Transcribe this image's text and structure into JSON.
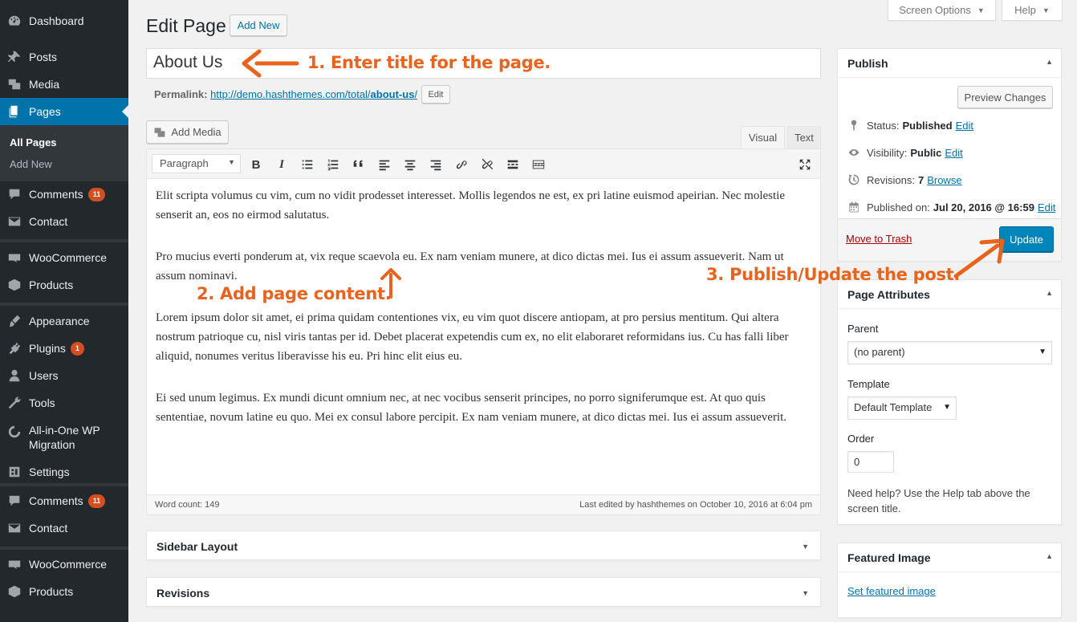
{
  "sidebar": {
    "items": [
      {
        "label": "Dashboard",
        "icon": "dashboard-icon"
      },
      {
        "label": "Posts",
        "icon": "pin-icon"
      },
      {
        "label": "Media",
        "icon": "media-icon"
      },
      {
        "label": "Pages",
        "icon": "pages-icon",
        "active": true
      },
      {
        "label": "Comments",
        "icon": "comments-icon",
        "badge": "11"
      },
      {
        "label": "Contact",
        "icon": "mail-icon"
      },
      {
        "label": "WooCommerce",
        "icon": "woo-icon"
      },
      {
        "label": "Products",
        "icon": "products-icon"
      },
      {
        "label": "Appearance",
        "icon": "brush-icon"
      },
      {
        "label": "Plugins",
        "icon": "plugin-icon",
        "badge": "1"
      },
      {
        "label": "Users",
        "icon": "users-icon"
      },
      {
        "label": "Tools",
        "icon": "wrench-icon"
      },
      {
        "label": "All-in-One WP Migration",
        "icon": "migration-icon"
      },
      {
        "label": "Settings",
        "icon": "settings-icon"
      },
      {
        "label": "Comments",
        "icon": "comments-icon",
        "badge": "11"
      },
      {
        "label": "Contact",
        "icon": "mail-icon"
      },
      {
        "label": "WooCommerce",
        "icon": "woo-icon"
      },
      {
        "label": "Products",
        "icon": "products-icon"
      }
    ],
    "submenu": [
      "All Pages",
      "Add New"
    ]
  },
  "header": {
    "title": "Edit Page",
    "add_new": "Add New",
    "screen_options": "Screen Options",
    "help": "Help"
  },
  "post": {
    "title": "About Us",
    "permalink_label": "Permalink:",
    "permalink_base": "http://demo.hashthemes.com/total/",
    "permalink_slug": "about-us",
    "permalink_trail": "/",
    "permalink_edit": "Edit"
  },
  "editor": {
    "add_media": "Add Media",
    "tab_visual": "Visual",
    "tab_text": "Text",
    "format": "Paragraph",
    "paragraphs": [
      "Elit scripta volumus cu vim, cum no vidit prodesset interesset. Mollis legendos ne est, ex pri latine euismod apeirian. Nec molestie senserit an, eos no eirmod salutatus.",
      "Pro mucius everti ponderum at, vix reque scaevola eu. Ex nam veniam munere, at dico dictas mei. Ius ei assum assueverit. Nam ut assum nominavi.",
      "Lorem ipsum dolor sit amet, ei prima quidam contentiones vix, eu vim quot discere antiopam, at pro persius mentitum. Qui altera nostrum patrioque cu, nisl viris tantas per id. Debet placerat expetendis cum ex, no elit elaboraret reformidans ius. Cu has falli liber aliquid, nonumes veritus liberavisse his eu. Pri hinc elit eius eu.",
      "Ei sed unum legimus. Ex mundi dicunt omnium nec, at nec vocibus senserit principes, no porro signiferumque est. At quo quis sententiae, novum latine eu quo. Mei ex consul labore percipit. Ex nam veniam munere, at dico dictas mei. Ius ei assum assueverit."
    ],
    "word_count": "Word count: 149",
    "last_edited": "Last edited by hashthemes on October 10, 2016 at 6:04 pm"
  },
  "boxes": {
    "sidebar_layout": "Sidebar Layout",
    "revisions": "Revisions"
  },
  "publish": {
    "title": "Publish",
    "preview": "Preview Changes",
    "status_label": "Status:",
    "status_value": "Published",
    "visibility_label": "Visibility:",
    "visibility_value": "Public",
    "revisions_label": "Revisions:",
    "revisions_value": "7",
    "browse": "Browse",
    "published_label": "Published on:",
    "published_value": "Jul 20, 2016 @ 16:59",
    "edit": "Edit",
    "trash": "Move to Trash",
    "update": "Update"
  },
  "page_attributes": {
    "title": "Page Attributes",
    "parent_label": "Parent",
    "parent_value": "(no parent)",
    "template_label": "Template",
    "template_value": "Default Template",
    "order_label": "Order",
    "order_value": "0",
    "help": "Need help? Use the Help tab above the screen title."
  },
  "featured_image": {
    "title": "Featured Image",
    "set_link": "Set featured image"
  },
  "annotations": {
    "step1": "1. Enter title for the page.",
    "step2": "2. Add page content.",
    "step3": "3. Publish/Update the post.",
    "color": "#e8631e"
  },
  "colors": {
    "sidebar_bg": "#23282d",
    "active_bg": "#0073aa",
    "primary_button": "#0085ba",
    "link": "#0073aa",
    "badge": "#d54e21"
  }
}
